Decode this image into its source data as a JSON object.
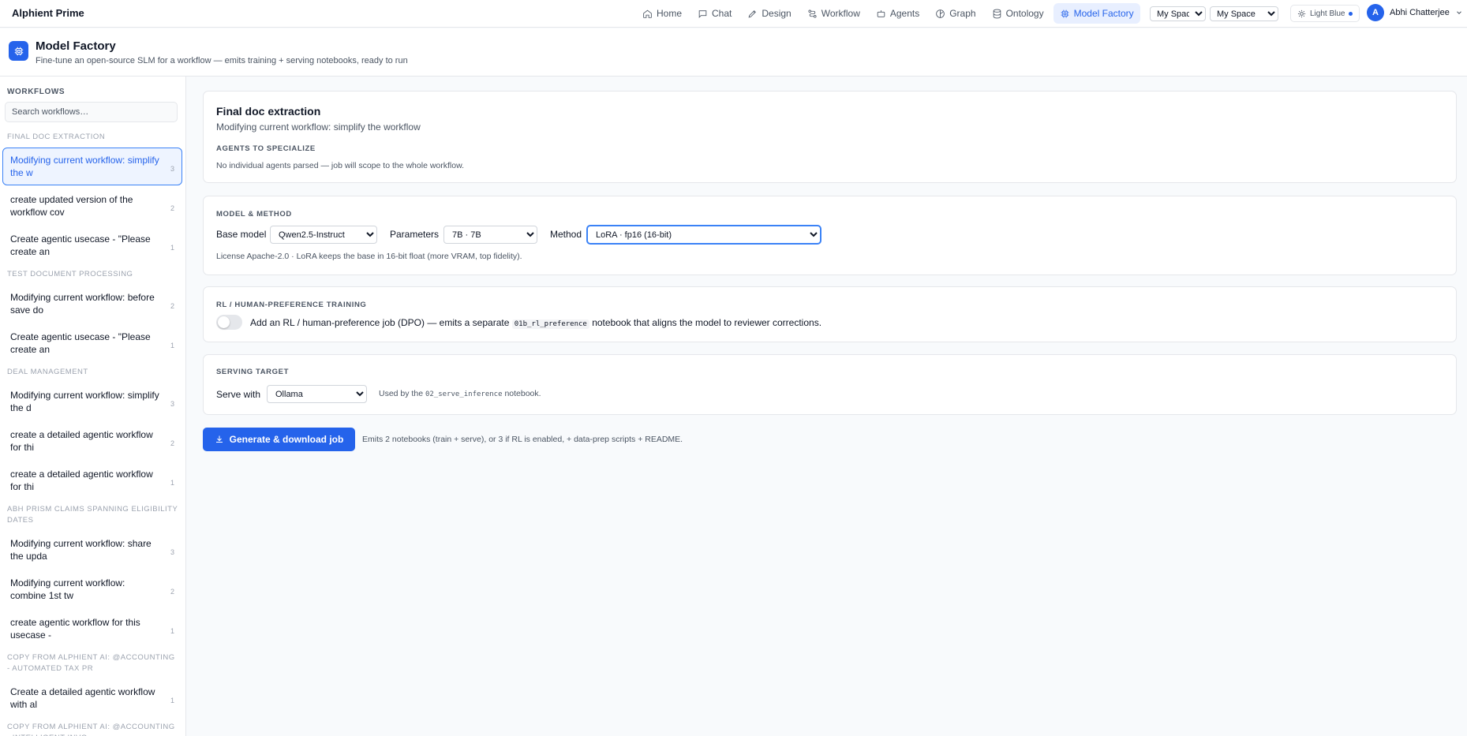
{
  "app": {
    "brand": "Alphient Prime"
  },
  "nav": [
    {
      "key": "home",
      "label": "Home",
      "icon": "home-icon"
    },
    {
      "key": "chat",
      "label": "Chat",
      "icon": "chat-icon"
    },
    {
      "key": "design",
      "label": "Design",
      "icon": "pen-icon"
    },
    {
      "key": "workflow",
      "label": "Workflow",
      "icon": "workflow-icon"
    },
    {
      "key": "agents",
      "label": "Agents",
      "icon": "bot-icon"
    },
    {
      "key": "graph",
      "label": "Graph",
      "icon": "graph-icon"
    },
    {
      "key": "ontology",
      "label": "Ontology",
      "icon": "database-icon"
    },
    {
      "key": "model-factory",
      "label": "Model Factory",
      "icon": "cpu-icon",
      "active": true
    }
  ],
  "header_controls": {
    "space_1": "My Space",
    "space_2": "My Space",
    "theme": "Light Blue",
    "user_initial": "A",
    "user_name": "Abhi Chatterjee"
  },
  "page": {
    "title": "Model Factory",
    "subtitle": "Fine-tune an open-source SLM for a workflow — emits training + serving notebooks, ready to run"
  },
  "sidebar": {
    "heading": "WORKFLOWS",
    "search_placeholder": "Search workflows…",
    "groups": [
      {
        "label": "FINAL DOC EXTRACTION",
        "items": [
          {
            "title": "Modifying current workflow: simplify the w",
            "count": "3",
            "active": true
          },
          {
            "title": "create updated version of the workflow cov",
            "count": "2"
          },
          {
            "title": "Create agentic usecase - \"Please create an",
            "count": "1"
          }
        ]
      },
      {
        "label": "TEST DOCUMENT PROCESSING",
        "items": [
          {
            "title": "Modifying current workflow: before save do",
            "count": "2"
          },
          {
            "title": "Create agentic usecase - \"Please create an",
            "count": "1"
          }
        ]
      },
      {
        "label": "DEAL MANAGEMENT",
        "items": [
          {
            "title": "Modifying current workflow: simplify the d",
            "count": "3"
          },
          {
            "title": "create a detailed agentic workflow for thi",
            "count": "2"
          },
          {
            "title": "create a detailed agentic workflow for thi",
            "count": "1"
          }
        ]
      },
      {
        "label": "ABH PRISM CLAIMS SPANNING ELIGIBILITY DATES",
        "items": [
          {
            "title": "Modifying current workflow: share the upda",
            "count": "3"
          },
          {
            "title": "Modifying current workflow: combine 1st tw",
            "count": "2"
          },
          {
            "title": "create agentic workflow for this usecase -",
            "count": "1"
          }
        ]
      },
      {
        "label": "COPY FROM ALPHIENT AI: @ACCOUNTING - AUTOMATED TAX PR",
        "items": [
          {
            "title": "Create a detailed agentic workflow with al",
            "count": "1"
          }
        ]
      },
      {
        "label": "COPY FROM ALPHIENT AI: @ACCOUNTING - INTELLIGENT INVO",
        "items": []
      }
    ]
  },
  "workflow_card": {
    "title": "Final doc extraction",
    "subtitle": "Modifying current workflow: simplify the workflow",
    "agents_heading": "AGENTS TO SPECIALIZE",
    "agents_note": "No individual agents parsed — job will scope to the whole workflow."
  },
  "model_card": {
    "heading": "MODEL & METHOD",
    "base_model_label": "Base model",
    "base_model_value": "Qwen2.5-Instruct",
    "params_label": "Parameters",
    "params_value": "7B · 7B",
    "method_label": "Method",
    "method_value": "LoRA · fp16 (16-bit)",
    "note": "License Apache-2.0 · LoRA keeps the base in 16-bit float (more VRAM, top fidelity)."
  },
  "rl_card": {
    "heading": "RL / HUMAN-PREFERENCE TRAINING",
    "text_before": "Add an RL / human-preference job (DPO) — emits a separate",
    "code": "01b_rl_preference",
    "text_after": "notebook that aligns the model to reviewer corrections.",
    "enabled": false
  },
  "serving_card": {
    "heading": "SERVING TARGET",
    "serve_label": "Serve with",
    "serve_value": "Ollama",
    "note_before": "Used by the",
    "note_code": "02_serve_inference",
    "note_after": "notebook."
  },
  "generate": {
    "button_label": "Generate & download job",
    "note": "Emits 2 notebooks (train + serve), or 3 if RL is enabled, + data-prep scripts + README."
  },
  "colors": {
    "accent": "#2563eb",
    "accent_bg": "#e8efff",
    "border": "#e5e7eb"
  }
}
